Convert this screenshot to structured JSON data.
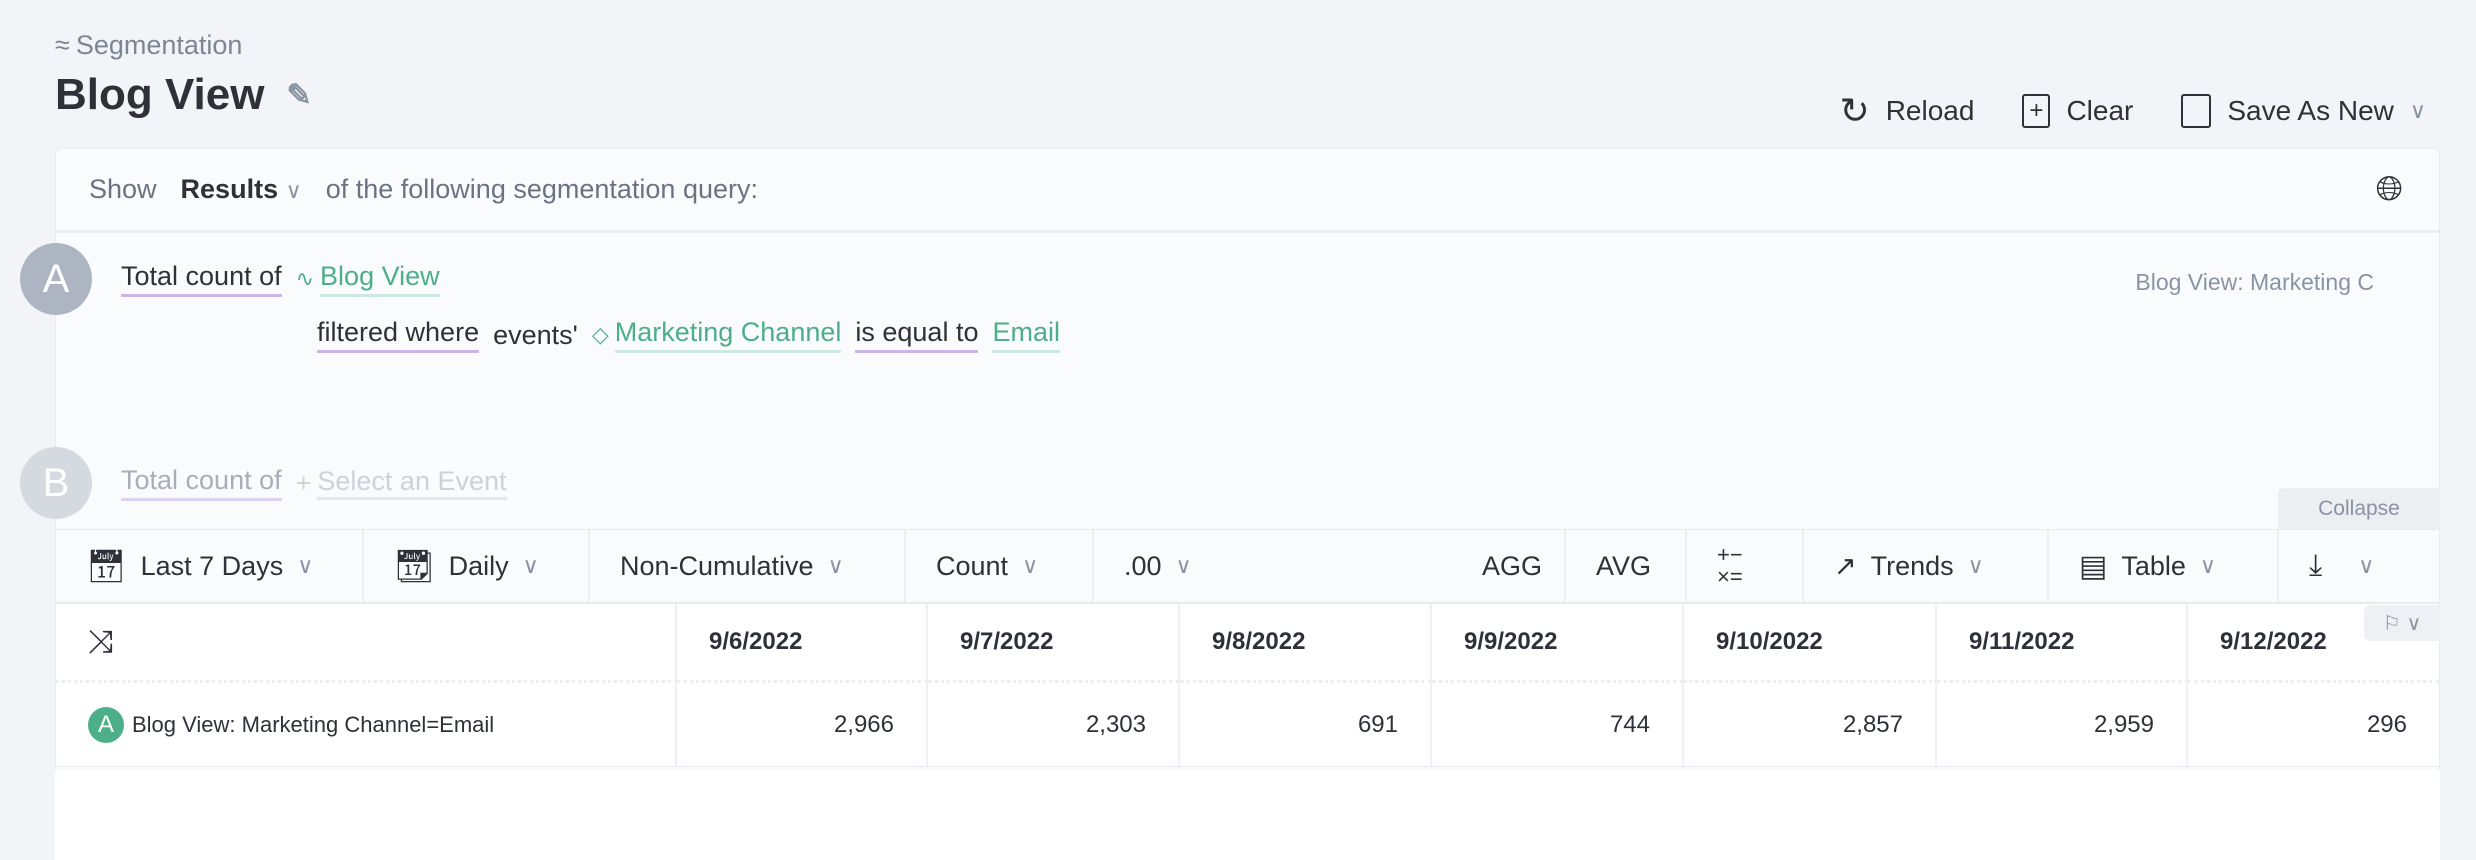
{
  "breadcrumb": {
    "label": "Segmentation",
    "icon": "trend-icon"
  },
  "page": {
    "title": "Blog View"
  },
  "actions": {
    "reload": "Reload",
    "clear": "Clear",
    "save": "Save As New"
  },
  "query": {
    "show": "Show",
    "mode": "Results",
    "suffix": "of the following segmentation query:",
    "a": {
      "letter": "A",
      "measure": "Total count of",
      "event": "Blog View",
      "filtered": "filtered where",
      "events": "events'",
      "property": "Marketing Channel",
      "operator": "is equal to",
      "value": "Email",
      "series_label": "Blog View: Marketing C"
    },
    "b": {
      "letter": "B",
      "measure": "Total count of",
      "placeholder": "Select an Event"
    }
  },
  "collapse": "Collapse",
  "toolbar": {
    "range": "Last 7 Days",
    "interval": "Daily",
    "cumulative": "Non-Cumulative",
    "metric": "Count",
    "decimals": ".00",
    "agg": "AGG",
    "avg": "AVG",
    "trends": "Trends",
    "view": "Table"
  },
  "table": {
    "headers": [
      "9/6/2022",
      "9/7/2022",
      "9/8/2022",
      "9/9/2022",
      "9/10/2022",
      "9/11/2022",
      "9/12/2022"
    ],
    "rows": [
      {
        "letter": "A",
        "label": "Blog View: Marketing Channel=Email",
        "values": [
          "2,966",
          "2,303",
          "691",
          "744",
          "2,857",
          "2,959",
          "296"
        ]
      }
    ]
  },
  "colors": {
    "accent": "#4dae8a",
    "underline": "#c9b5e8",
    "circle_a": "#adb5c2"
  }
}
